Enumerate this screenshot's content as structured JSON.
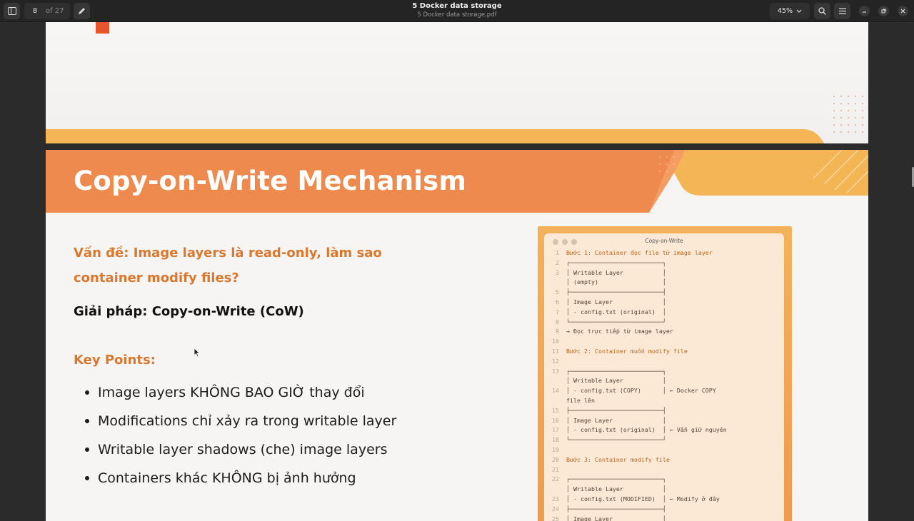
{
  "header": {
    "page_current": "8",
    "page_total": "of 27",
    "title": "5 Docker data storage",
    "subtitle": "5 Docker data storage.pdf",
    "zoom": "45%"
  },
  "slide": {
    "title": "Copy-on-Write Mechanism",
    "problem": "Vấn đề: Image layers là read-only, làm sao container modify files?",
    "solution": "Giải pháp: Copy-on-Write (CoW)",
    "key_points_title": "Key Points:",
    "key_points": [
      "Image layers KHÔNG BAO GIỜ thay đổi",
      "Modifications chỉ xảy ra trong writable layer",
      "Writable layer shadows (che) image layers",
      "Containers khác KHÔNG bị ảnh hưởng"
    ]
  },
  "code_window": {
    "title": "Copy-on-Write",
    "lines": [
      {
        "n": "1",
        "t": "Bước 1: Container đọc file từ image layer",
        "h": true
      },
      {
        "n": "2",
        "t": "┌──────────────────────────┐"
      },
      {
        "n": "3",
        "t": "│ Writable Layer           │"
      },
      {
        "n": "",
        "t": "│ (empty)                  │"
      },
      {
        "n": "5",
        "t": "├──────────────────────────┤"
      },
      {
        "n": "6",
        "t": "│ Image Layer              │"
      },
      {
        "n": "7",
        "t": "│ - config.txt (original)  │"
      },
      {
        "n": "8",
        "t": "└──────────────────────────┘"
      },
      {
        "n": "9",
        "t": "→ Đọc trực tiếp từ image layer"
      },
      {
        "n": "10",
        "t": ""
      },
      {
        "n": "11",
        "t": "Bước 2: Container muốn modify file",
        "h": true
      },
      {
        "n": "12",
        "t": ""
      },
      {
        "n": "13",
        "t": "┌──────────────────────────┐"
      },
      {
        "n": "",
        "t": "│ Writable Layer           │"
      },
      {
        "n": "14",
        "t": "│ - config.txt (COPY)      │ ← Docker COPY"
      },
      {
        "n": "",
        "t": "file lên"
      },
      {
        "n": "15",
        "t": "├──────────────────────────┤"
      },
      {
        "n": "16",
        "t": "│ Image Layer              │"
      },
      {
        "n": "17",
        "t": "│ - config.txt (original)  │ ← Vẫn giữ nguyên"
      },
      {
        "n": "18",
        "t": "└──────────────────────────┘"
      },
      {
        "n": "19",
        "t": ""
      },
      {
        "n": "20",
        "t": "Bước 3: Container modify file",
        "h": true
      },
      {
        "n": "21",
        "t": ""
      },
      {
        "n": "22",
        "t": "┌──────────────────────────┐"
      },
      {
        "n": "",
        "t": "│ Writable Layer           │"
      },
      {
        "n": "23",
        "t": "│ - config.txt (MODIFIED)  │ ← Modify ở đây"
      },
      {
        "n": "24",
        "t": "├──────────────────────────┤"
      },
      {
        "n": "25",
        "t": "│ Image Layer              │"
      }
    ]
  },
  "colors": {
    "accent_orange": "#d8782f",
    "banner_orange": "#ef8a4f",
    "banner_yellow": "#f4b655"
  },
  "icons": [
    "sidebar-toggle-icon",
    "annotate-pen-icon",
    "chevron-down-icon",
    "search-icon",
    "menu-icon",
    "minimize-icon",
    "restore-icon",
    "close-icon",
    "mouse-cursor-icon"
  ]
}
